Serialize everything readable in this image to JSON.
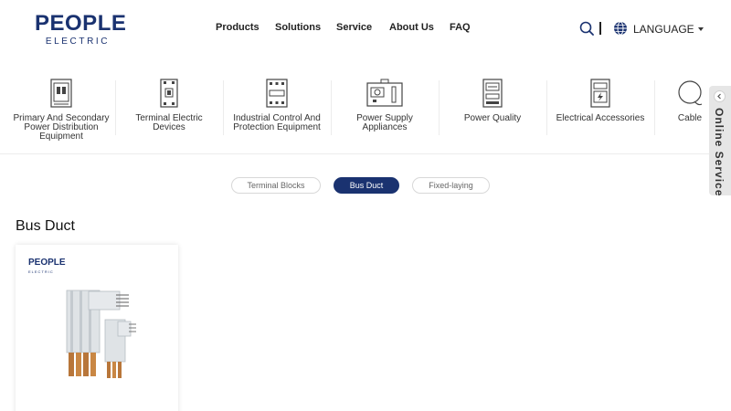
{
  "brand": {
    "name": "PEOPLE",
    "sub": "ELECTRIC",
    "color": "#1a3270"
  },
  "nav": {
    "items": [
      {
        "label": "Products"
      },
      {
        "label": "Solutions"
      },
      {
        "label": "Service"
      },
      {
        "label": "About Us"
      },
      {
        "label": "FAQ"
      }
    ],
    "search_icon": "search-icon",
    "language_label": "LANGUAGE"
  },
  "categories": [
    {
      "label": "Primary And Secondary Power Distribution Equipment",
      "icon": "switchgear-cabinet-icon"
    },
    {
      "label": "Terminal Electric Devices",
      "icon": "circuit-breaker-icon"
    },
    {
      "label": "Industrial Control And Protection Equipment",
      "icon": "contactor-icon"
    },
    {
      "label": "Power Supply Appliances",
      "icon": "power-supply-icon"
    },
    {
      "label": "Power Quality",
      "icon": "power-meter-icon"
    },
    {
      "label": "Electrical Accessories",
      "icon": "socket-box-icon"
    },
    {
      "label": "Cable",
      "icon": "cable-reel-icon"
    }
  ],
  "tabs": [
    {
      "label": "Terminal Blocks",
      "active": false
    },
    {
      "label": "Bus Duct",
      "active": true
    },
    {
      "label": "Fixed-laying",
      "active": false
    }
  ],
  "section_title": "Bus Duct",
  "product_card": {
    "logo_main": "PEOPLE",
    "logo_sub": "ELECTRIC",
    "image": "bus-duct-product-image"
  },
  "online_service": {
    "label": "Online Service"
  }
}
